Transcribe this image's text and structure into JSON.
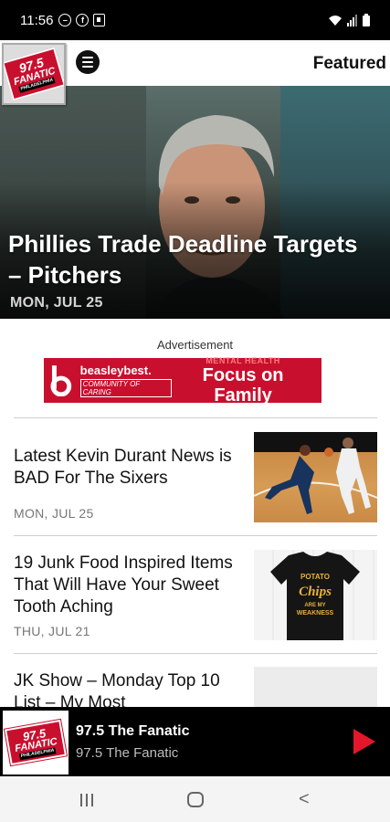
{
  "status_bar": {
    "time": "11:56",
    "icons": [
      "do-not-disturb-icon",
      "facebook-icon",
      "notification-icon",
      "wifi-icon",
      "signal-icon",
      "battery-icon"
    ]
  },
  "header": {
    "logo": {
      "line1": "97.5",
      "line2": "FANATIC",
      "line3": "PHILADELPHIA"
    },
    "title": "Featured"
  },
  "hero": {
    "title": "Phillies Trade Deadline Targets – Pitchers",
    "date": "MON, JUL 25"
  },
  "ad": {
    "label": "Advertisement",
    "brand": "beasleybest.",
    "tagline": "COMMUNITY OF CARING",
    "kicker": "MENTAL HEALTH",
    "headline": "Focus on Family",
    "accent_color": "#c8102e"
  },
  "articles": [
    {
      "title": "Latest Kevin Durant News is BAD For The Sixers",
      "date": "MON, JUL 25",
      "thumb": "basketball-photo"
    },
    {
      "title": "19 Junk Food Inspired Items That Will Have Your Sweet Tooth Aching",
      "date": "THU, JUL 21",
      "thumb": "tshirt-photo",
      "shirt_text": {
        "l1": "POTATO",
        "l2": "Chips",
        "l3": "ARE MY",
        "l4": "WEAKNESS"
      }
    },
    {
      "title": "JK Show – Monday Top 10 List – My Most",
      "date": "",
      "thumb": "placeholder"
    }
  ],
  "player": {
    "logo": {
      "line1": "97.5",
      "line2": "FANATIC",
      "line3": "PHILADELPHIA"
    },
    "title": "97.5 The Fanatic",
    "subtitle": "97.5 The Fanatic",
    "play_color": "#e4162b"
  }
}
